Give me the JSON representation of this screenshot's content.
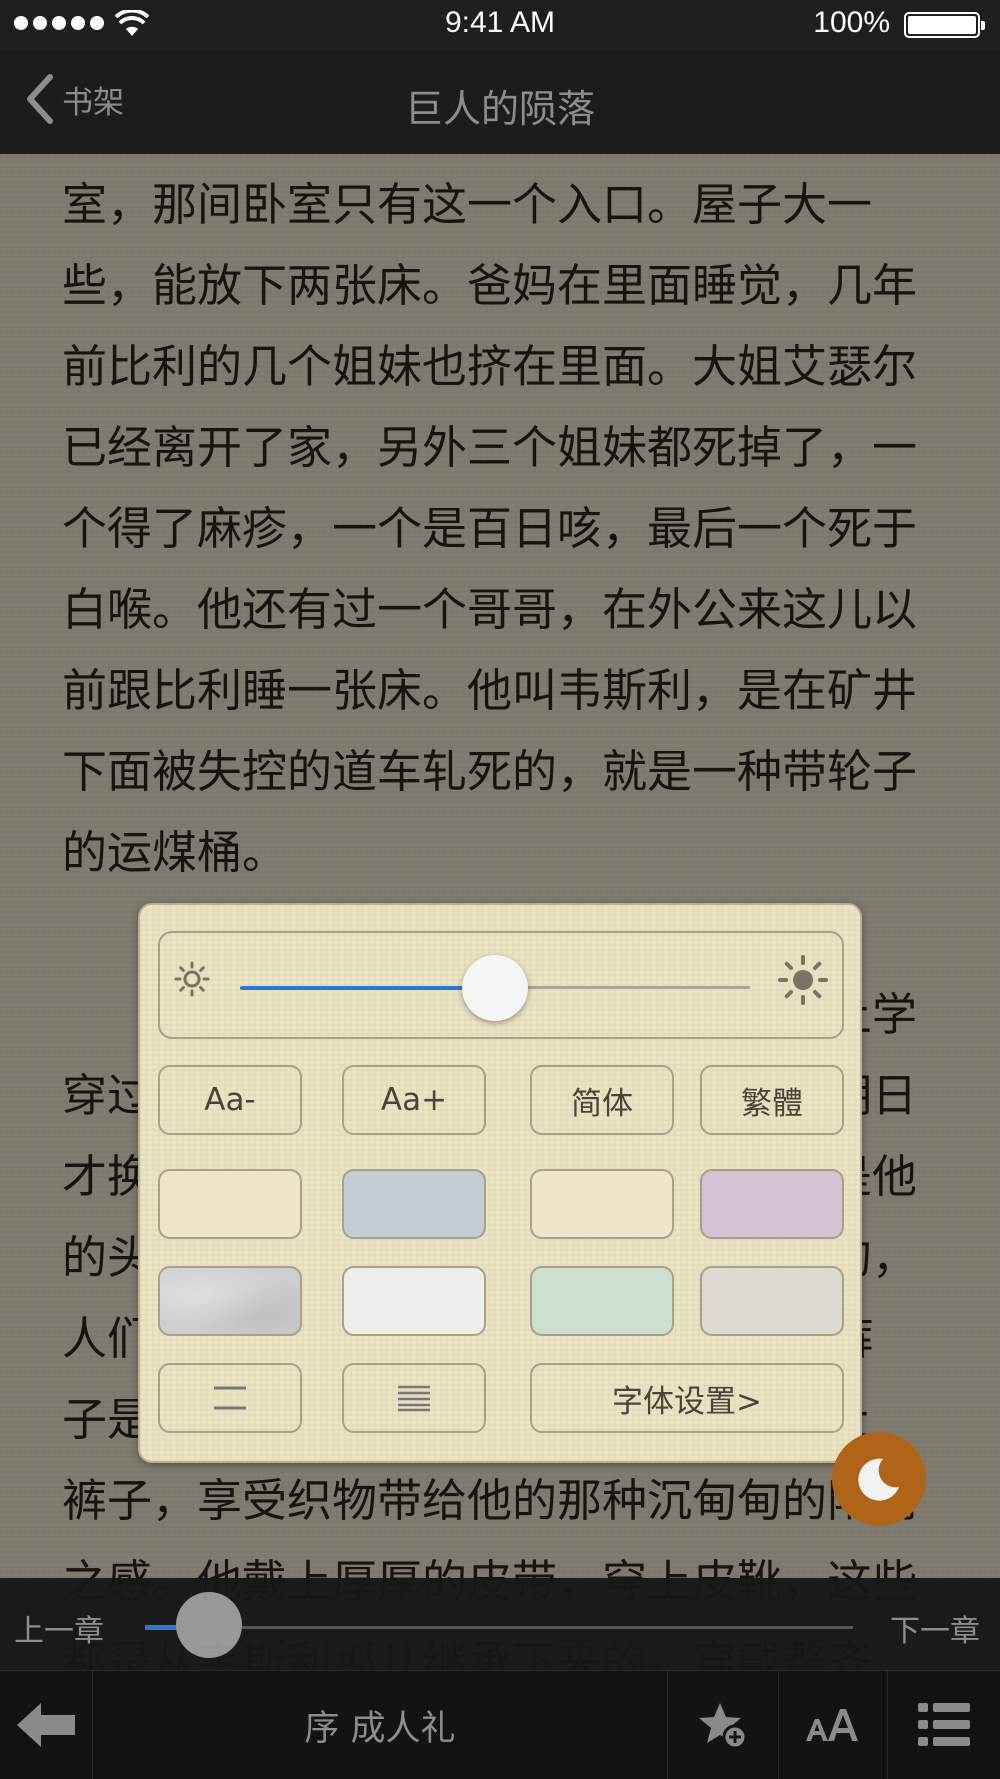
{
  "status_bar": {
    "time": "9:41 AM",
    "battery": "100%"
  },
  "nav": {
    "back_label": "书架",
    "title": "巨人的陨落"
  },
  "content": {
    "lines": [
      "室，那间卧室只有这一个入口。屋子大一",
      "些，能放下两张床。爸妈在里面睡觉，几年",
      "前比利的几个姐妹也挤在里面。大姐艾瑟尔",
      "已经离开了家，另外三个姐妹都死掉了，一",
      "个得了麻疹，一个是百日咳，最后一个死于",
      "白喉。他还有过一个哥哥，在外公来这儿以",
      "前跟比利睡一张床。他叫韦斯利，是在矿井",
      "下面被失控的道车轧死的，就是一种带轮子",
      "的运煤桶。",
      "",
      "　　比利穿上衬衫，这件衬衫是他昨天上学",
      "穿过的。今天是星期四，他每次都是星期日",
      "才换衬衫。不过，他有一条新裤子，这是他",
      "的头一条长裤，是用厚厚的防水棉布做的，",
      "人们管那种厚斜纹布叫“鼹鼠皮”。这种裤",
      "子是进入男人世界的象征，他自豪地穿上",
      "裤子，享受织物带给他的那种沉甸甸的阳刚",
      "之感。他戴上厚厚的皮带，穿上皮靴，这些",
      "都是从韦斯利那儿继承下来的。穿戴整齐"
    ]
  },
  "settings_panel": {
    "brightness_level": 0.5,
    "font_decrease": "Aa-",
    "font_increase": "Aa+",
    "simplified": "简体",
    "traditional": "繁體",
    "themes_row1": [
      "#ede5c6",
      "#c3cdd6",
      "#efe5c9",
      "#d5c2d5"
    ],
    "themes_row2": [
      "#cfcfcf",
      "#eeeeea",
      "#cddfce",
      "#dcdad3"
    ],
    "spacing_wide_icon": "wide-line-spacing-icon",
    "spacing_narrow_icon": "narrow-line-spacing-icon",
    "font_settings": "字体设置>"
  },
  "progress": {
    "prev_label": "上一章",
    "next_label": "下一章",
    "position": 0.09
  },
  "toolbar": {
    "chapter": "序 成人礼"
  },
  "colors": {
    "accent": "#2479d8",
    "night_button": "#b06418"
  }
}
